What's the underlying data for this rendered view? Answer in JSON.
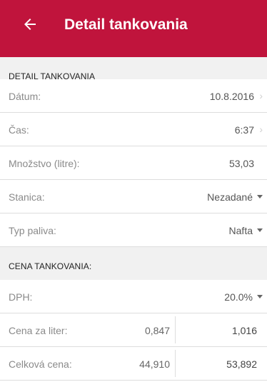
{
  "appbar": {
    "title": "Detail tankovania",
    "back_icon": "arrow-left-icon"
  },
  "detail_section": {
    "header": "DETAIL TANKOVANIA",
    "rows": {
      "date": {
        "label": "Dátum:",
        "value": "10.8.2016"
      },
      "time": {
        "label": "Čas:",
        "value": "6:37"
      },
      "amount": {
        "label": "Množstvo (litre):",
        "value": "53,03"
      },
      "station": {
        "label": "Stanica:",
        "value": "Nezadané"
      },
      "fuel": {
        "label": "Typ paliva:",
        "value": "Nafta"
      }
    }
  },
  "price_section": {
    "header": "CENA TANKOVANIA:",
    "vat": {
      "label": "DPH:",
      "value": "20.0%"
    },
    "price_per_liter": {
      "label": "Cena za liter:",
      "without_vat": "0,847",
      "with_vat": "1,016"
    },
    "total_price": {
      "label": "Celková cena:",
      "without_vat": "44,910",
      "with_vat": "53,892"
    }
  },
  "colors": {
    "appbar": "#c0143c",
    "section_bg": "#f1f1f1",
    "divider": "#dddddd"
  }
}
